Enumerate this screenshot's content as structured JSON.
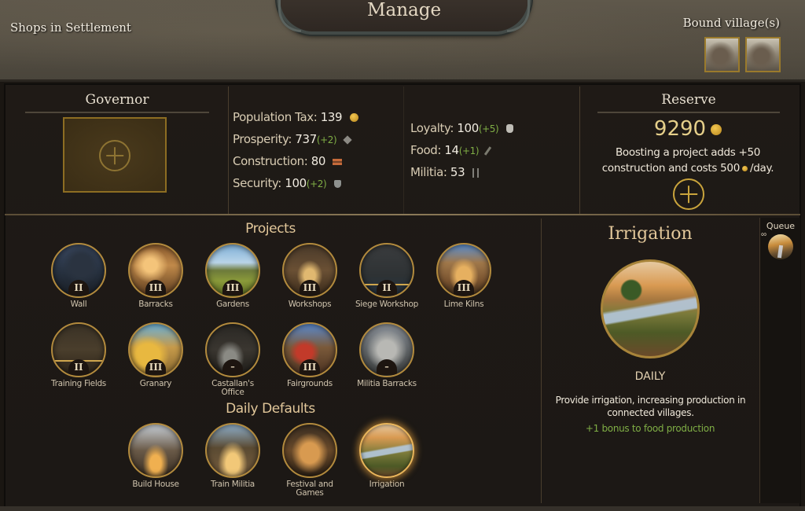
{
  "header": {
    "title": "Manage",
    "shops_label": "Shops in Settlement",
    "bound_villages_label": "Bound village(s)",
    "bound_villages": [
      "village-1",
      "village-2"
    ]
  },
  "governor": {
    "title": "Governor",
    "slot_icon": "plus-icon"
  },
  "stats": {
    "left": [
      {
        "label": "Population Tax:",
        "value": "139",
        "change": "",
        "icon": "coin-icon"
      },
      {
        "label": "Prosperity:",
        "value": "737",
        "change": "(+2)",
        "icon": "prosperity-icon"
      },
      {
        "label": "Construction:",
        "value": "80",
        "change": "",
        "icon": "bricks-icon"
      },
      {
        "label": "Security:",
        "value": "100",
        "change": "(+2)",
        "icon": "shield-icon"
      }
    ],
    "right": [
      {
        "label": "Loyalty:",
        "value": "100",
        "change": "(+5)",
        "icon": "mask-icon"
      },
      {
        "label": "Food:",
        "value": "14",
        "change": "(+1)",
        "icon": "wheat-icon"
      },
      {
        "label": "Militia:",
        "value": "53",
        "change": "",
        "icon": "pitchfork-icon"
      }
    ]
  },
  "reserve": {
    "title": "Reserve",
    "amount": "9290",
    "desc_line1": "Boosting a project adds +50",
    "desc_line2a": "construction and costs 500",
    "desc_line2b": "/day."
  },
  "projects": {
    "title": "Projects",
    "items": [
      {
        "name": "Wall",
        "tier": "II",
        "img": "wall"
      },
      {
        "name": "Barracks",
        "tier": "III",
        "img": "barracks"
      },
      {
        "name": "Gardens",
        "tier": "III",
        "img": "gardens"
      },
      {
        "name": "Workshops",
        "tier": "III",
        "img": "workshops"
      },
      {
        "name": "Siege Workshop",
        "tier": "II",
        "img": "siege"
      },
      {
        "name": "Lime Kilns",
        "tier": "III",
        "img": "lime"
      },
      {
        "name": "Training Fields",
        "tier": "II",
        "img": "training"
      },
      {
        "name": "Granary",
        "tier": "III",
        "img": "granary"
      },
      {
        "name": "Castallan's Office",
        "tier": "–",
        "img": "castallan"
      },
      {
        "name": "Fairgrounds",
        "tier": "III",
        "img": "fair"
      },
      {
        "name": "Militia Barracks",
        "tier": "–",
        "img": "militia-b"
      }
    ]
  },
  "daily_defaults": {
    "title": "Daily Defaults",
    "items": [
      {
        "name": "Build House",
        "img": "house"
      },
      {
        "name": "Train Militia",
        "img": "train"
      },
      {
        "name": "Festival and Games",
        "img": "festival"
      },
      {
        "name": "Irrigation",
        "img": "irrigation",
        "selected": true
      }
    ]
  },
  "detail": {
    "title": "Irrigation",
    "type": "DAILY",
    "description": "Provide irrigation, increasing production in connected villages.",
    "bonus": "+1 bonus to food production"
  },
  "queue": {
    "label": "Queue",
    "infinite_symbol": "∞",
    "items": [
      "Irrigation"
    ]
  },
  "colors": {
    "gold": "#c9a43c",
    "positive": "#7fae45",
    "accent_text": "#e2c79a"
  }
}
